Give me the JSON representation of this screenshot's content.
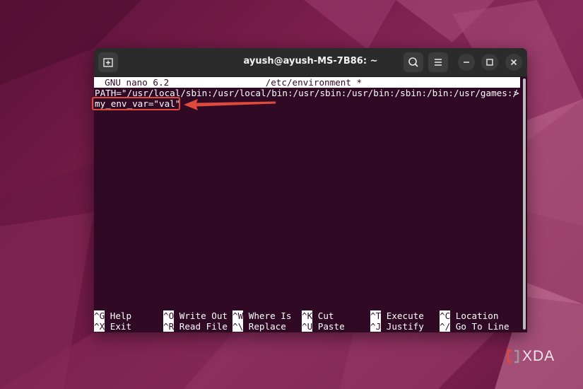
{
  "window": {
    "title": "ayush@ayush-MS-7B86: ~"
  },
  "nano": {
    "header": "  GNU nano 6.2                  /etc/environment *",
    "lines": [
      "PATH=\"/usr/local/sbin:/usr/local/bin:/usr/sbin:/usr/bin:/sbin:/bin:/usr/games:/",
      "my_env_var=\"val\""
    ],
    "overflow_marker": ">",
    "shortcuts": [
      {
        "key": "^G",
        "label": "Help"
      },
      {
        "key": "^O",
        "label": "Write Out"
      },
      {
        "key": "^W",
        "label": "Where Is"
      },
      {
        "key": "^K",
        "label": "Cut"
      },
      {
        "key": "^T",
        "label": "Execute"
      },
      {
        "key": "^C",
        "label": "Location"
      },
      {
        "key": "^X",
        "label": "Exit"
      },
      {
        "key": "^R",
        "label": "Read File"
      },
      {
        "key": "^\\",
        "label": "Replace"
      },
      {
        "key": "^U",
        "label": "Paste"
      },
      {
        "key": "^J",
        "label": "Justify"
      },
      {
        "key": "^/",
        "label": "Go To Line"
      }
    ]
  },
  "watermark": {
    "text": "XDA"
  },
  "colors": {
    "terminal_bg": "#300a24",
    "annotation": "#e04a3c"
  }
}
